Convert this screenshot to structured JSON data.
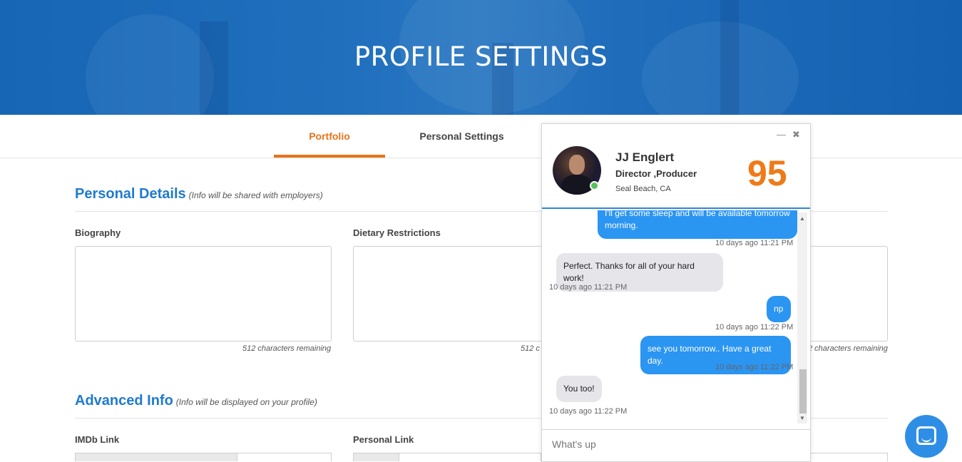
{
  "header": {
    "title": "PROFILE SETTINGS"
  },
  "tabs": [
    {
      "label": "Portfolio",
      "active": true
    },
    {
      "label": "Personal Settings",
      "active": false
    }
  ],
  "personal_details": {
    "title": "Personal Details",
    "note": "(Info will be shared with employers)",
    "fields": [
      {
        "label": "Biography",
        "remaining": "512 characters remaining"
      },
      {
        "label": "Dietary Restrictions",
        "remaining": "512 c"
      },
      {
        "label": "",
        "remaining": "2 characters remaining"
      }
    ]
  },
  "advanced_info": {
    "title": "Advanced Info",
    "note": "(Info will be displayed on your profile)",
    "imdb_label": "IMDb Link",
    "personal_link_label": "Personal Link"
  },
  "chat": {
    "minimize_icon": "minimize-icon",
    "close_icon": "close-icon",
    "name": "JJ Englert",
    "role": "Director ,Producer",
    "location": "Seal Beach, CA",
    "score": "95",
    "messages": [
      {
        "dir": "out",
        "text": "I'll get some sleep and will be available tomorrow morning.",
        "time": "10 days ago 11:21 PM"
      },
      {
        "dir": "in",
        "text": "Perfect. Thanks for all of your hard work!",
        "time": "10 days ago 11:21 PM"
      },
      {
        "dir": "out",
        "text": "np",
        "time": "10 days ago 11:22 PM"
      },
      {
        "dir": "out",
        "text": "see you tomorrow.. Have a great day.",
        "time": "10 days ago 11:22 PM"
      },
      {
        "dir": "in",
        "text": "You too!",
        "time": "10 days ago 11:22 PM"
      }
    ],
    "compose_placeholder": "What's up"
  },
  "colors": {
    "accent_orange": "#e8731b",
    "brand_blue": "#1f7ad0",
    "bubble_blue": "#2b95f2"
  }
}
